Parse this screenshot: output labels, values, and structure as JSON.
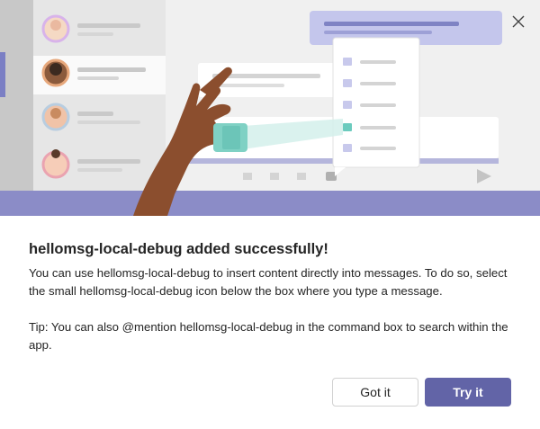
{
  "dialog": {
    "title": "hellomsg-local-debug added successfully!",
    "body_1": "You can use hellomsg-local-debug to insert content directly into messages. To do so, select the small hellomsg-local-debug icon below the box where you type a message.",
    "body_2": "Tip: You can also @mention hellomsg-local-debug in the command box to search within the app.",
    "close_icon": "close-icon",
    "buttons": {
      "secondary_label": "Got it",
      "primary_label": "Try it"
    }
  },
  "colors": {
    "accent": "#6264a7",
    "hero_band": "#8b8cc7"
  }
}
